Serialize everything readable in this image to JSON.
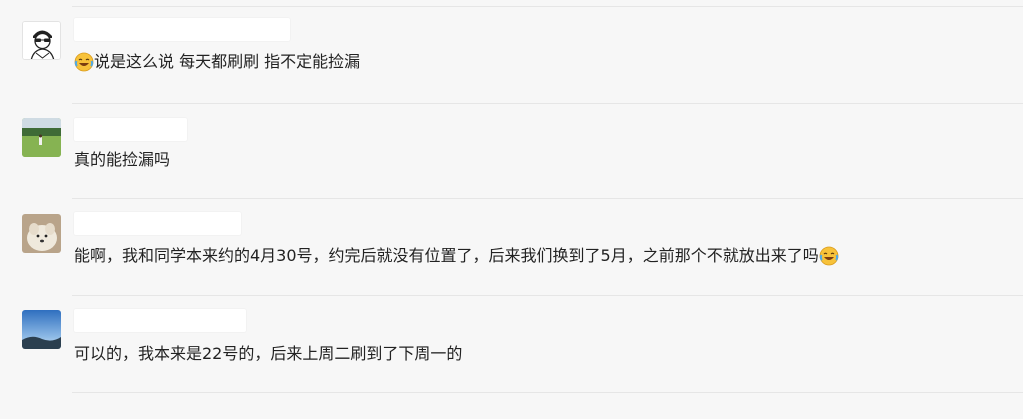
{
  "messages": [
    {
      "avatar": "sketch-person-avatar",
      "name": "",
      "pre_emoji": "laughing-crying-emoji",
      "text": "说是这么说 每天都刷刷 指不定能捡漏",
      "post_emoji": ""
    },
    {
      "avatar": "field-photo-avatar",
      "name": "",
      "pre_emoji": "",
      "text": "真的能捡漏吗",
      "post_emoji": ""
    },
    {
      "avatar": "dog-photo-avatar",
      "name": "",
      "pre_emoji": "",
      "text": "能啊，我和同学本来约的4月30号，约完后就没有位置了，后来我们换到了5月，之前那个不就放出来了吗",
      "post_emoji": "laughing-crying-emoji"
    },
    {
      "avatar": "sky-photo-avatar",
      "name": "",
      "pre_emoji": "",
      "text": "可以的，我本来是22号的，后来上周二刷到了下周一的",
      "post_emoji": ""
    }
  ],
  "colors": {
    "background": "#f7f7f7",
    "divider": "#e6e6e6",
    "text": "#222222",
    "name_placeholder": "#ffffff"
  }
}
